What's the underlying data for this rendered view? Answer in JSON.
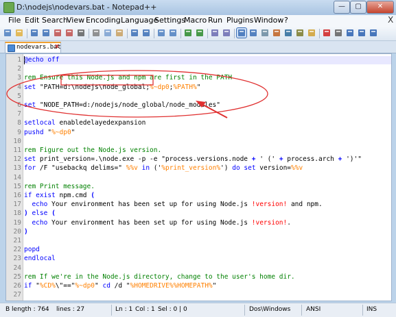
{
  "window": {
    "title": "D:\\nodejs\\nodevars.bat - Notepad++",
    "minimize_glyph": "—",
    "maximize_glyph": "▢",
    "close_glyph": "✕"
  },
  "menu": {
    "items": [
      "File",
      "Edit",
      "Search",
      "View",
      "Encoding",
      "Language",
      "Settings",
      "Macro",
      "Run",
      "Plugins",
      "Window",
      "?"
    ],
    "close_glyph": "X"
  },
  "toolbar": {
    "icons": [
      "new-file-icon",
      "open-file-icon",
      "save-icon",
      "save-all-icon",
      "close-icon",
      "close-all-icon",
      "print-icon",
      "cut-icon",
      "copy-icon",
      "paste-icon",
      "undo-icon",
      "redo-icon",
      "find-icon",
      "replace-icon",
      "zoom-in-icon",
      "zoom-out-icon",
      "sync-vertical-icon",
      "sync-horizontal-icon",
      "word-wrap-icon",
      "show-all-chars-icon",
      "indent-guide-icon",
      "user-language-icon",
      "doc-map-icon",
      "function-list-icon",
      "folder-workspace-icon",
      "record-macro-icon",
      "stop-record-icon",
      "play-macro-icon",
      "run-macro-multiple-icon",
      "save-macro-icon"
    ]
  },
  "tabs": [
    {
      "label": "nodevars.bat",
      "close_glyph": "x"
    }
  ],
  "editor": {
    "line_numbers": [
      "1",
      "2",
      "3",
      "4",
      "5",
      "6",
      "7",
      "8",
      "9",
      "10",
      "11",
      "12",
      "13",
      "14",
      "15",
      "16",
      "17",
      "18",
      "19",
      "20",
      "21",
      "22",
      "23",
      "24",
      "25",
      "26",
      "27"
    ],
    "lines": [
      [
        {
          "t": "@echo off",
          "k": "k"
        }
      ],
      [
        {
          "t": "",
          "k": ""
        }
      ],
      [
        {
          "t": "rem Ensure this Node.js and npm are first in the PATH",
          "k": "c"
        }
      ],
      [
        {
          "t": "set ",
          "k": "k"
        },
        {
          "t": "\"PATH=d:\\nodejs\\node_global;",
          "k": ""
        },
        {
          "t": "%~dp0",
          "k": "v"
        },
        {
          "t": ";",
          "k": ""
        },
        {
          "t": "%PATH%",
          "k": "v"
        },
        {
          "t": "\"",
          "k": ""
        }
      ],
      [
        {
          "t": "",
          "k": ""
        }
      ],
      [
        {
          "t": "set ",
          "k": "k"
        },
        {
          "t": "\"NODE_PATH=d:/nodejs/node_global/node_modules\"",
          "k": ""
        }
      ],
      [
        {
          "t": "",
          "k": ""
        }
      ],
      [
        {
          "t": "setlocal ",
          "k": "k"
        },
        {
          "t": "enabledelayedexpansion",
          "k": ""
        }
      ],
      [
        {
          "t": "pushd ",
          "k": "k"
        },
        {
          "t": "\"",
          "k": ""
        },
        {
          "t": "%~dp0",
          "k": "v"
        },
        {
          "t": "\"",
          "k": ""
        }
      ],
      [
        {
          "t": "",
          "k": ""
        }
      ],
      [
        {
          "t": "rem Figure out the Node.js version.",
          "k": "c"
        }
      ],
      [
        {
          "t": "set ",
          "k": "k"
        },
        {
          "t": "print_version=.\\node.exe -p -e \"process.versions.node ",
          "k": ""
        },
        {
          "t": "+",
          "k": "o"
        },
        {
          "t": " ' (' ",
          "k": ""
        },
        {
          "t": "+",
          "k": "o"
        },
        {
          "t": " process.arch ",
          "k": ""
        },
        {
          "t": "+",
          "k": "o"
        },
        {
          "t": " ')'\"",
          "k": ""
        }
      ],
      [
        {
          "t": "for ",
          "k": "k"
        },
        {
          "t": "/F \"usebackq delims=\" ",
          "k": ""
        },
        {
          "t": "%%v",
          "k": "v"
        },
        {
          "t": " in ",
          "k": "k"
        },
        {
          "t": "('",
          "k": ""
        },
        {
          "t": "%print_version%",
          "k": "v"
        },
        {
          "t": "') ",
          "k": ""
        },
        {
          "t": "do set ",
          "k": "k"
        },
        {
          "t": "version=",
          "k": ""
        },
        {
          "t": "%%v",
          "k": "v"
        }
      ],
      [
        {
          "t": "",
          "k": ""
        }
      ],
      [
        {
          "t": "rem Print message.",
          "k": "c"
        }
      ],
      [
        {
          "t": "if exist ",
          "k": "k"
        },
        {
          "t": "npm.cmd ",
          "k": ""
        },
        {
          "t": "(",
          "k": "o"
        }
      ],
      [
        {
          "t": "  echo ",
          "k": "k"
        },
        {
          "t": "Your environment has been set up for using Node.js ",
          "k": ""
        },
        {
          "t": "!version!",
          "k": "dv"
        },
        {
          "t": " and npm.",
          "k": ""
        }
      ],
      [
        {
          "t": ") ",
          "k": "o"
        },
        {
          "t": "else ",
          "k": "k"
        },
        {
          "t": "(",
          "k": "o"
        }
      ],
      [
        {
          "t": "  echo ",
          "k": "k"
        },
        {
          "t": "Your environment has been set up for using Node.js ",
          "k": ""
        },
        {
          "t": "!version!",
          "k": "dv"
        },
        {
          "t": ".",
          "k": ""
        }
      ],
      [
        {
          "t": ")",
          "k": "o"
        }
      ],
      [
        {
          "t": "",
          "k": ""
        }
      ],
      [
        {
          "t": "popd",
          "k": "k"
        }
      ],
      [
        {
          "t": "endlocal",
          "k": "k"
        }
      ],
      [
        {
          "t": "",
          "k": ""
        }
      ],
      [
        {
          "t": "rem If we're in the Node.js directory, change to the user's home dir.",
          "k": "c"
        }
      ],
      [
        {
          "t": "if ",
          "k": "k"
        },
        {
          "t": "\"",
          "k": ""
        },
        {
          "t": "%CD%",
          "k": "v"
        },
        {
          "t": "\\\"==\"",
          "k": ""
        },
        {
          "t": "%~dp0",
          "k": "v"
        },
        {
          "t": "\" ",
          "k": ""
        },
        {
          "t": "cd ",
          "k": "k"
        },
        {
          "t": "/d \"",
          "k": ""
        },
        {
          "t": "%HOMEDRIVE%%HOMEPATH%",
          "k": "v"
        },
        {
          "t": "\"",
          "k": ""
        }
      ],
      [
        {
          "t": "",
          "k": ""
        }
      ]
    ]
  },
  "status": {
    "length": "B length : 764",
    "lines": "lines : 27",
    "ln": "Ln : 1",
    "col": "Col : 1",
    "sel": "Sel : 0 | 0",
    "eol": "Dos\\Windows",
    "encoding": "ANSI",
    "mode": "INS"
  },
  "colors": {
    "keyword": "#0000ff",
    "comment": "#008000",
    "variable": "#ff8000",
    "delayed_var": "#ff0000",
    "annotation": "#e03030"
  }
}
